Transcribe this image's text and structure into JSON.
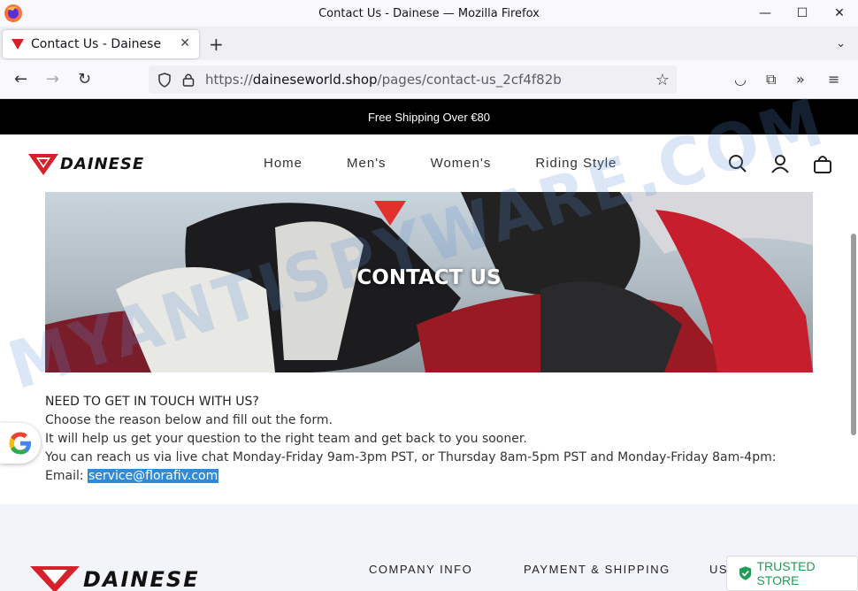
{
  "window": {
    "title": "Contact Us - Dainese — Mozilla Firefox"
  },
  "tab": {
    "title": "Contact Us - Dainese"
  },
  "urlbar": {
    "prefix": "https://",
    "domain": "daineseworld.shop",
    "path": "/pages/contact-us_2cf4f82b"
  },
  "site": {
    "announcement": "Free Shipping Over €80",
    "logo_text": "DAINESE",
    "menu": [
      "Home",
      "Men's",
      "Women's",
      "Riding Style"
    ]
  },
  "hero": {
    "title": "CONTACT US"
  },
  "content": {
    "heading": "NEED TO GET IN TOUCH WITH US?",
    "line1": "Choose the reason below and fill out the form.",
    "line2": "It will help us get your question to the right team and get back to you sooner.",
    "line3": "You can reach us via live chat Monday-Friday 9am-3pm PST, or Thursday 8am-5pm PST and Monday-Friday 8am-4pm:",
    "email_label": "Email: ",
    "email": "service@florafiv.com"
  },
  "footer": {
    "logo_text": "DAINESE",
    "columns": [
      "COMPANY INFO",
      "PAYMENT & SHIPPING",
      "US"
    ]
  },
  "trusted_badge": "TRUSTED STORE",
  "watermark": "MYANTISPYWARE.COM",
  "colors": {
    "brand_red": "#d6202a",
    "email_highlight": "#2f8ad8",
    "trusted_green": "#1f9d55"
  }
}
